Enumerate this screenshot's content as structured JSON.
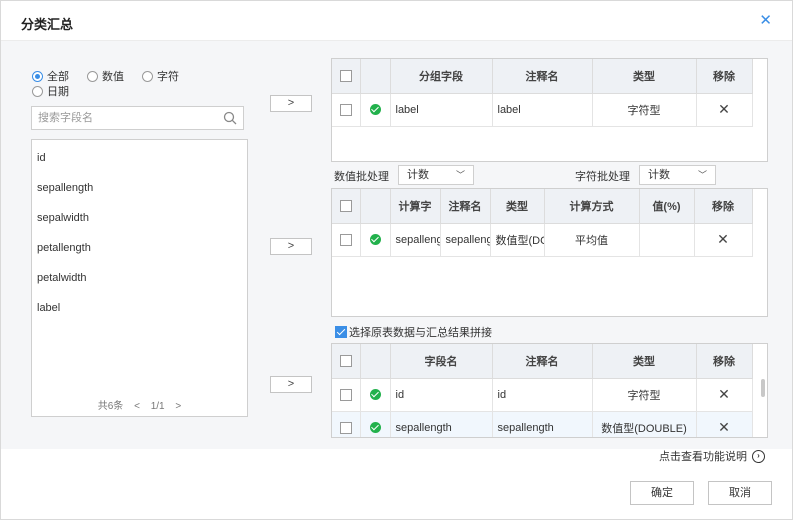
{
  "dialog": {
    "title": "分类汇总",
    "close_symbol": "✕"
  },
  "filter": {
    "options": [
      {
        "label": "全部",
        "selected": true
      },
      {
        "label": "数值",
        "selected": false
      },
      {
        "label": "字符",
        "selected": false
      },
      {
        "label": "日期",
        "selected": false
      }
    ]
  },
  "search": {
    "placeholder": "搜索字段名",
    "value": ""
  },
  "fields": [
    "id",
    "sepallength",
    "sepalwidth",
    "petallength",
    "petalwidth",
    "label"
  ],
  "pager": {
    "total": "共6条",
    "prev": "<",
    "page": "1/1",
    "next": ">"
  },
  "arrow_label": ">",
  "group_table": {
    "headers": [
      "分组字段",
      "注释名",
      "类型",
      "移除"
    ],
    "rows": [
      {
        "field": "label",
        "alias": "label",
        "type": "字符型"
      }
    ]
  },
  "numeric_batch": {
    "label": "数值批处理",
    "value": "计数"
  },
  "string_batch": {
    "label": "字符批处理",
    "value": "计数"
  },
  "calc_table": {
    "headers": [
      "计算字",
      "注释名",
      "类型",
      "计算方式",
      "值(%)",
      "移除"
    ],
    "rows": [
      {
        "field": "sepalleng",
        "alias": "sepalleng",
        "type": "数值型(DC",
        "method": "平均值",
        "value": ""
      }
    ]
  },
  "concat_option": {
    "label": "选择原表数据与汇总结果拼接",
    "checked": true
  },
  "result_table": {
    "headers": [
      "字段名",
      "注释名",
      "类型",
      "移除"
    ],
    "rows": [
      {
        "field": "id",
        "alias": "id",
        "type": "字符型"
      },
      {
        "field": "sepallength",
        "alias": "sepallength",
        "type": "数值型(DOUBLE)"
      }
    ]
  },
  "help_link": "点击查看功能说明",
  "buttons": {
    "confirm": "确定",
    "cancel": "取消"
  },
  "remove_symbol": "✕"
}
